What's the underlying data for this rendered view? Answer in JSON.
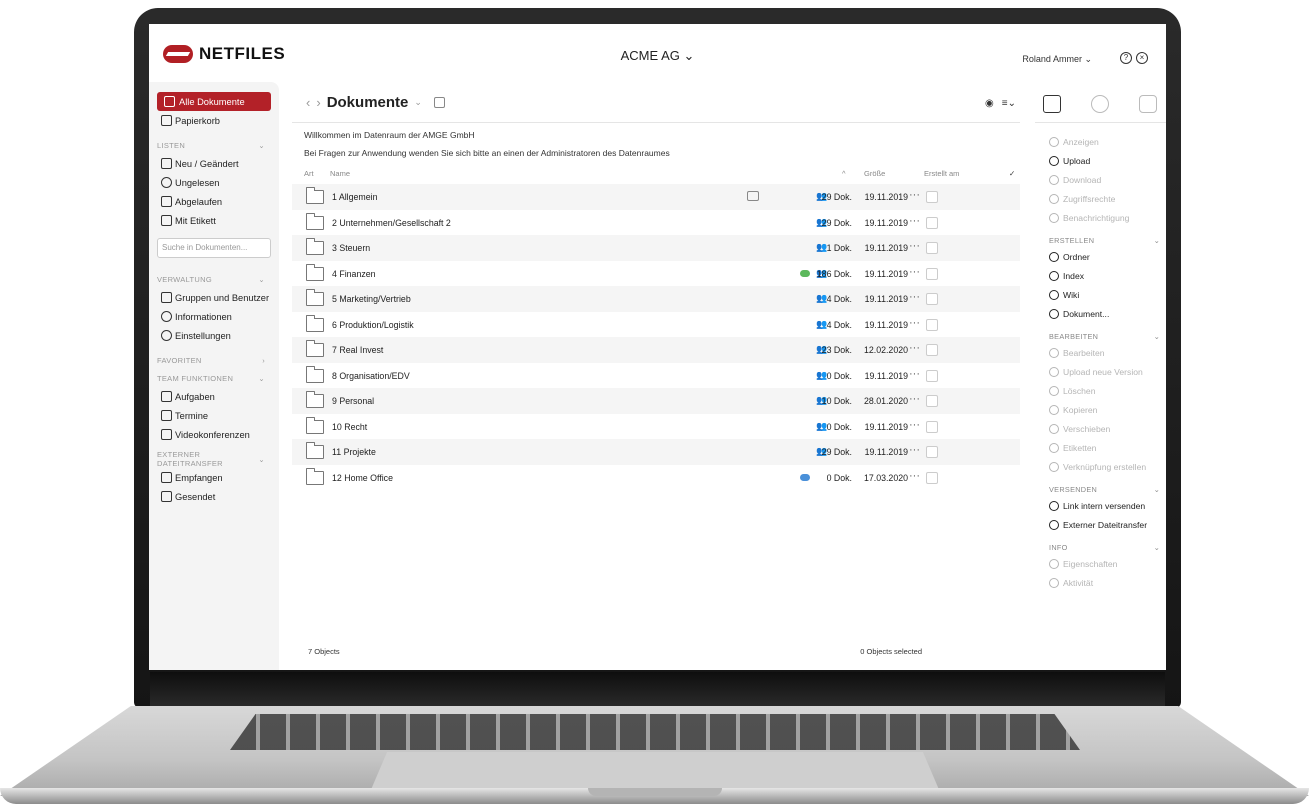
{
  "app": {
    "logo_text": "NETFILES",
    "company": "ACME AG ⌄",
    "user": "Roland Ammer ⌄"
  },
  "sidebar": {
    "top": [
      {
        "label": "Alle Dokumente",
        "icon": "documents-icon"
      },
      {
        "label": "Papierkorb",
        "icon": "trash-icon"
      }
    ],
    "listen": {
      "header": "LISTEN",
      "items": [
        {
          "label": "Neu / Geändert",
          "icon": "document-icon"
        },
        {
          "label": "Ungelesen",
          "icon": "eye-icon"
        },
        {
          "label": "Abgelaufen",
          "icon": "document-icon"
        },
        {
          "label": "Mit Etikett",
          "icon": "tag-icon"
        }
      ]
    },
    "search_placeholder": "Suche in Dokumenten...",
    "verwaltung": {
      "header": "VERWALTUNG",
      "items": [
        {
          "label": "Gruppen und Benutzer",
          "icon": "users-icon"
        },
        {
          "label": "Informationen",
          "icon": "info-icon"
        },
        {
          "label": "Einstellungen",
          "icon": "gear-icon"
        }
      ]
    },
    "favoriten": {
      "header": "FAVORITEN"
    },
    "team": {
      "header": "TEAM FUNKTIONEN",
      "items": [
        {
          "label": "Aufgaben",
          "icon": "checkbox-icon"
        },
        {
          "label": "Termine",
          "icon": "calendar-icon"
        },
        {
          "label": "Videokonferenzen",
          "icon": "video-icon"
        }
      ]
    },
    "extern": {
      "header": "EXTERNER DATEITRANSFER",
      "items": [
        {
          "label": "Empfangen",
          "icon": "inbox-icon"
        },
        {
          "label": "Gesendet",
          "icon": "send-icon"
        }
      ]
    }
  },
  "main": {
    "title": "Dokumente",
    "welcome": "Willkommen im Datenraum der AMGE GmbH",
    "welcome2": "Bei Fragen zur Anwendung wenden Sie sich bitte an einen der Administratoren des Datenraumes",
    "columns": {
      "art": "Art",
      "name": "Name",
      "size": "Größe",
      "created": "Erstellt am"
    },
    "rows": [
      {
        "name": "1 Allgemein",
        "size": "29 Dok.",
        "date": "19.11.2019",
        "comment": true,
        "tag": ""
      },
      {
        "name": "2 Unternehmen/Gesellschaft 2",
        "size": "29 Dok.",
        "date": "19.11.2019",
        "comment": false,
        "tag": ""
      },
      {
        "name": "3 Steuern",
        "size": "1 Dok.",
        "date": "19.11.2019",
        "comment": false,
        "tag": ""
      },
      {
        "name": "4 Finanzen",
        "size": "186 Dok.",
        "date": "19.11.2019",
        "comment": false,
        "tag": "#5cb85c"
      },
      {
        "name": "5 Marketing/Vertrieb",
        "size": "4 Dok.",
        "date": "19.11.2019",
        "comment": false,
        "tag": ""
      },
      {
        "name": "6 Produktion/Logistik",
        "size": "4 Dok.",
        "date": "19.11.2019",
        "comment": false,
        "tag": ""
      },
      {
        "name": "7 Real Invest",
        "size": "23 Dok.",
        "date": "12.02.2020",
        "comment": false,
        "tag": ""
      },
      {
        "name": "8 Organisation/EDV",
        "size": "0 Dok.",
        "date": "19.11.2019",
        "comment": false,
        "tag": ""
      },
      {
        "name": "9 Personal",
        "size": "10 Dok.",
        "date": "28.01.2020",
        "comment": false,
        "tag": ""
      },
      {
        "name": "10 Recht",
        "size": "0 Dok.",
        "date": "19.11.2019",
        "comment": false,
        "tag": ""
      },
      {
        "name": "11 Projekte",
        "size": "29 Dok.",
        "date": "19.11.2019",
        "comment": false,
        "tag": ""
      },
      {
        "name": "12 Home Office",
        "size": "0 Dok.",
        "date": "17.03.2020",
        "comment": false,
        "tag": "#4a90d9"
      }
    ],
    "footer_left": "7 Objects",
    "footer_right": "0 Objects selected"
  },
  "rpanel": {
    "top": [
      {
        "label": "Anzeigen",
        "disabled": true
      },
      {
        "label": "Upload",
        "disabled": false
      },
      {
        "label": "Download",
        "disabled": true
      },
      {
        "label": "Zugriffsrechte",
        "disabled": true
      },
      {
        "label": "Benachrichtigung",
        "disabled": true
      }
    ],
    "erstellen": {
      "header": "ERSTELLEN",
      "items": [
        {
          "label": "Ordner",
          "disabled": false
        },
        {
          "label": "Index",
          "disabled": false
        },
        {
          "label": "Wiki",
          "disabled": false
        },
        {
          "label": "Dokument...",
          "disabled": false
        }
      ]
    },
    "bearbeiten": {
      "header": "BEARBEITEN",
      "items": [
        {
          "label": "Bearbeiten",
          "disabled": true
        },
        {
          "label": "Upload neue Version",
          "disabled": true
        },
        {
          "label": "Löschen",
          "disabled": true
        },
        {
          "label": "Kopieren",
          "disabled": true
        },
        {
          "label": "Verschieben",
          "disabled": true
        },
        {
          "label": "Etiketten",
          "disabled": true
        },
        {
          "label": "Verknüpfung erstellen",
          "disabled": true
        }
      ]
    },
    "versenden": {
      "header": "VERSENDEN",
      "items": [
        {
          "label": "Link intern versenden",
          "disabled": false
        },
        {
          "label": "Externer Dateitransfer",
          "disabled": false
        }
      ]
    },
    "info": {
      "header": "INFO",
      "items": [
        {
          "label": "Eigenschaften",
          "disabled": true
        },
        {
          "label": "Aktivität",
          "disabled": true
        }
      ]
    }
  }
}
